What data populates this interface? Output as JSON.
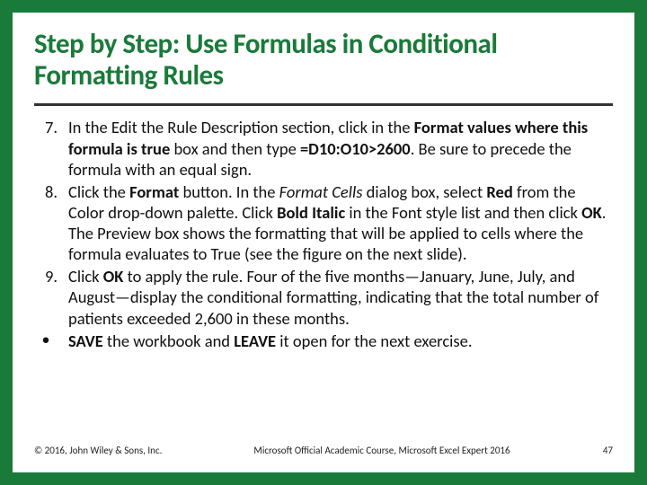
{
  "title": "Step by Step: Use Formulas in Conditional Formatting Rules",
  "items": [
    {
      "marker": "7.",
      "segments": [
        {
          "t": "In the Edit the Rule Description section, click in the "
        },
        {
          "t": "Format values where this formula is true",
          "b": true
        },
        {
          "t": " box and then type "
        },
        {
          "t": "=D10:O10>2600",
          "b": true
        },
        {
          "t": ". Be sure to precede the formula with an equal sign."
        }
      ]
    },
    {
      "marker": "8.",
      "segments": [
        {
          "t": "Click the "
        },
        {
          "t": "Format",
          "b": true
        },
        {
          "t": " button. In the "
        },
        {
          "t": "Format Cells",
          "i": true
        },
        {
          "t": " dialog box, select "
        },
        {
          "t": "Red",
          "b": true
        },
        {
          "t": " from the Color drop-down palette. Click "
        },
        {
          "t": "Bold Italic",
          "b": true
        },
        {
          "t": " in the Font style list and then click "
        },
        {
          "t": "OK",
          "b": true
        },
        {
          "t": ". The Preview box shows the formatting that will be applied to cells where the formula evaluates to True (see the figure on the next slide)."
        }
      ]
    },
    {
      "marker": "9.",
      "segments": [
        {
          "t": "Click "
        },
        {
          "t": "OK",
          "b": true
        },
        {
          "t": " to apply the rule. Four of the five months—January, June, July, and August—display the conditional formatting, indicating that the total number of patients exceeded 2,600 in these months."
        }
      ]
    },
    {
      "marker": "•",
      "bullet": true,
      "segments": [
        {
          "t": "SAVE",
          "b": true
        },
        {
          "t": " the workbook and "
        },
        {
          "t": "LEAVE",
          "b": true
        },
        {
          "t": " it open for the next exercise."
        }
      ]
    }
  ],
  "footer": {
    "left": "© 2016, John Wiley & Sons, Inc.",
    "center": "Microsoft Official Academic Course, Microsoft Excel Expert 2016",
    "right": "47"
  }
}
